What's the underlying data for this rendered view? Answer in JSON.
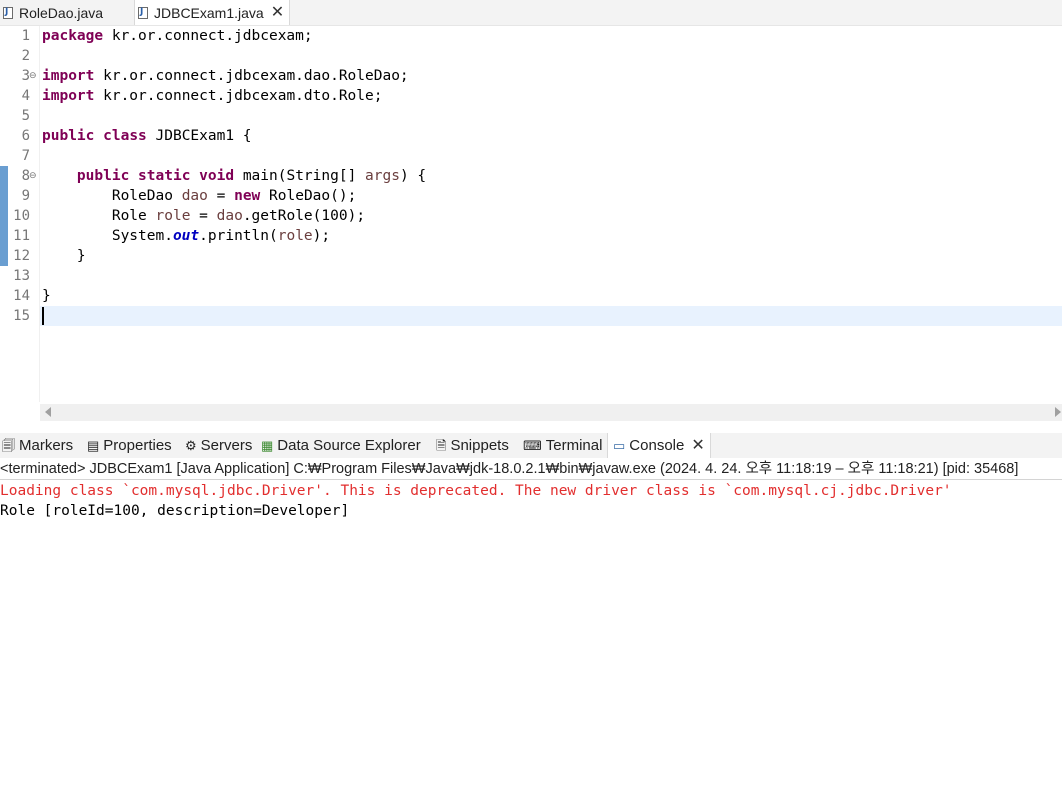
{
  "editor_tabs": [
    {
      "label": "RoleDao.java",
      "icon": "java-file-icon"
    },
    {
      "label": "JDBCExam1.java",
      "icon": "java-file-icon",
      "active": true,
      "close": "✕"
    }
  ],
  "line_numbers": [
    "1",
    "2",
    "3",
    "4",
    "5",
    "6",
    "7",
    "8",
    "9",
    "10",
    "11",
    "12",
    "13",
    "14",
    "15"
  ],
  "code": {
    "l1": {
      "kw": "package",
      "rest": " kr.or.connect.jdbcexam;"
    },
    "l3": {
      "kw": "import",
      "rest": " kr.or.connect.jdbcexam.dao.RoleDao;"
    },
    "l4": {
      "kw": "import",
      "rest": " kr.or.connect.jdbcexam.dto.Role;"
    },
    "l6": {
      "kw1": "public",
      "kw2": "class",
      "rest": " JDBCExam1 {"
    },
    "l8": {
      "indent": "    ",
      "kw1": "public",
      "kw2": "static",
      "kw3": "void",
      "rest1": " main(String[] ",
      "var": "args",
      "rest2": ") {"
    },
    "l9": {
      "indent": "        ",
      "t1": "RoleDao ",
      "var": "dao",
      "t2": " = ",
      "kw": "new",
      "t3": " RoleDao();"
    },
    "l10": {
      "indent": "        ",
      "t1": "Role ",
      "var1": "role",
      "t2": " = ",
      "var2": "dao",
      "t3": ".getRole(100);"
    },
    "l11": {
      "indent": "        ",
      "t1": "System.",
      "fld": "out",
      "t2": ".println(",
      "var": "role",
      "t3": ");"
    },
    "l12": {
      "text": "    }"
    },
    "l14": {
      "text": "}"
    }
  },
  "views": [
    {
      "label": "Markers",
      "icon": "markers-icon"
    },
    {
      "label": "Properties",
      "icon": "properties-icon"
    },
    {
      "label": "Servers",
      "icon": "servers-icon"
    },
    {
      "label": "Data Source Explorer",
      "icon": "data-source-icon"
    },
    {
      "label": "Snippets",
      "icon": "snippets-icon"
    },
    {
      "label": "Terminal",
      "icon": "terminal-icon"
    },
    {
      "label": "Console",
      "icon": "console-icon",
      "active": true,
      "close": "✕"
    }
  ],
  "console": {
    "status": "<terminated> JDBCExam1 [Java Application] C:₩Program Files₩Java₩jdk-18.0.2.1₩bin₩javaw.exe  (2024. 4. 24. 오후 11:18:19 – 오후 11:18:21) [pid: 35468]",
    "lines": [
      "Loading class `com.mysql.jdbc.Driver'. This is deprecated. The new driver class is `com.mysql.cj.jdbc.Driver'",
      "Role [roleId=100, description=Developer]"
    ]
  },
  "colors": {
    "keyword": "#7f0055",
    "local_var": "#6a3e3e",
    "static_field": "#0000c0",
    "stderr": "#e22e2e",
    "current_line": "#e8f2fe"
  }
}
